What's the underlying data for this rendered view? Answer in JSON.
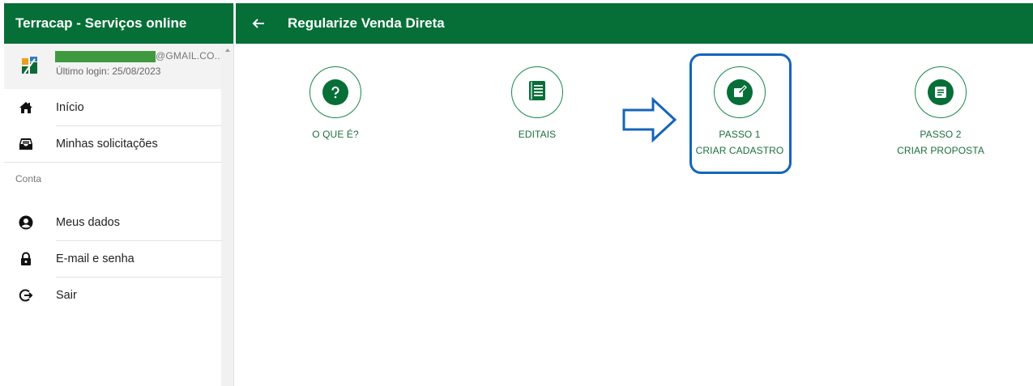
{
  "sidebar": {
    "title": "Terracap - Serviços online",
    "user": {
      "email_suffix": "@GMAIL.CO...",
      "last_login": "Último login: 25/08/2023"
    },
    "items": [
      {
        "label": "Início",
        "icon": "home-icon"
      },
      {
        "label": "Minhas solicitações",
        "icon": "inbox-icon"
      }
    ],
    "section_label": "Conta",
    "account_items": [
      {
        "label": "Meus dados",
        "icon": "account-circle-icon"
      },
      {
        "label": "E-mail e senha",
        "icon": "lock-icon"
      },
      {
        "label": "Sair",
        "icon": "logout-icon"
      }
    ]
  },
  "header": {
    "title": "Regularize Venda Direta"
  },
  "main": {
    "cards": [
      {
        "line1": "O QUE É?",
        "line2": "",
        "icon": "question-icon"
      },
      {
        "line1": "EDITAIS",
        "line2": "",
        "icon": "book-icon"
      },
      {
        "line1": "PASSO 1",
        "line2": "CRIAR CADASTRO",
        "icon": "edit-icon"
      },
      {
        "line1": "PASSO 2",
        "line2": "CRIAR PROPOSTA",
        "icon": "document-icon"
      }
    ]
  },
  "colors": {
    "brand_green": "#066f37",
    "highlight_blue": "#1565b8"
  }
}
